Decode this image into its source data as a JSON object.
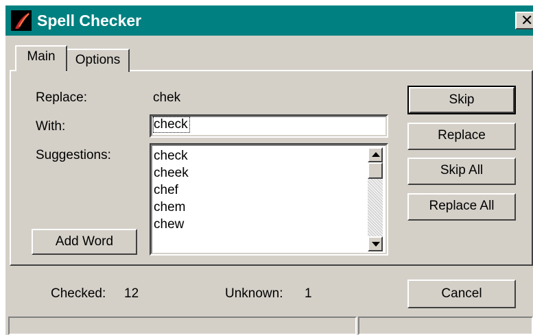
{
  "window": {
    "title": "Spell Checker",
    "close_label": "✕"
  },
  "tabs": [
    {
      "label": "Main",
      "selected": true
    },
    {
      "label": "Options",
      "selected": false
    }
  ],
  "main": {
    "replace_label": "Replace:",
    "replace_value": "chek",
    "with_label": "With:",
    "with_value": "check",
    "suggestions_label": "Suggestions:",
    "suggestions": [
      "check",
      "cheek",
      "chef",
      "chem",
      "chew"
    ],
    "add_word_label": "Add Word"
  },
  "buttons": {
    "skip": "Skip",
    "replace": "Replace",
    "skip_all": "Skip All",
    "replace_all": "Replace All",
    "cancel": "Cancel"
  },
  "footer": {
    "checked_label": "Checked:",
    "checked_value": "12",
    "unknown_label": "Unknown:",
    "unknown_value": "1"
  },
  "colors": {
    "titlebar": "#008080",
    "face": "#d4d0c8"
  },
  "icons": {
    "app": "quill-app-icon",
    "close": "close-icon"
  }
}
